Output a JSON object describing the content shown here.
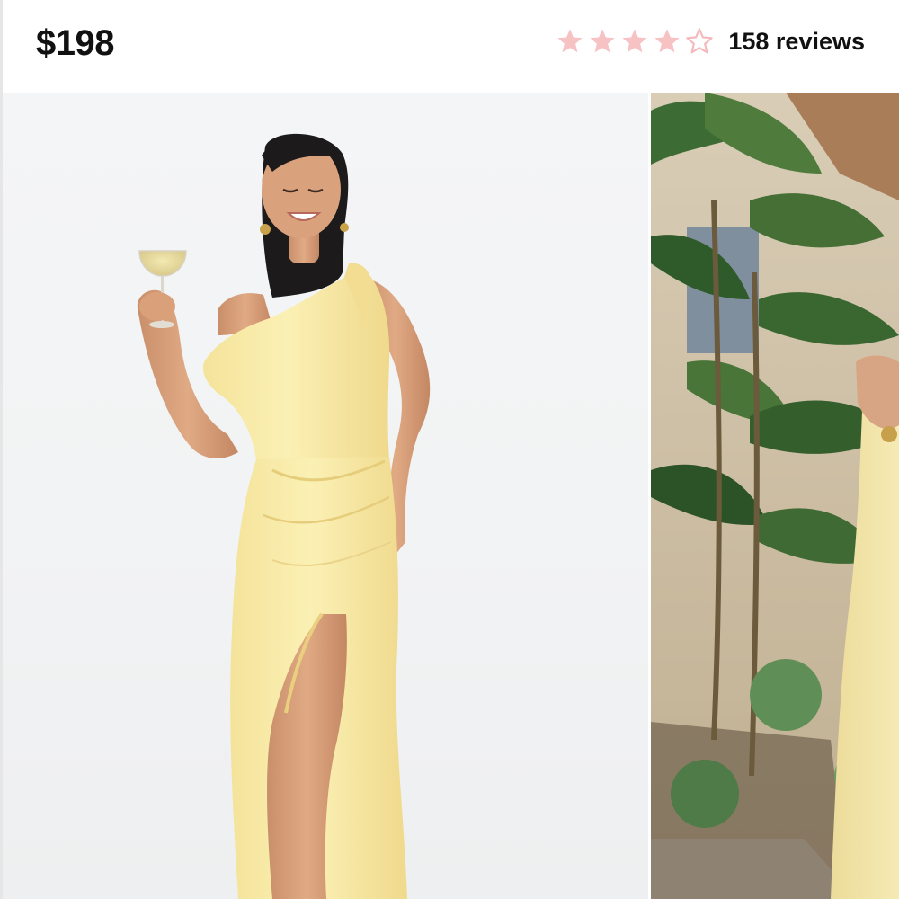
{
  "product": {
    "price": "$198",
    "rating": {
      "value": 4,
      "max": 5,
      "reviews_label": "158 reviews",
      "filled_color": "#f6c2c4",
      "empty_color": "#f3b9bc"
    }
  },
  "gallery": {
    "slides": [
      {
        "alt": "Model in yellow satin one-shoulder maxi dress holding a champagne glass"
      },
      {
        "alt": "Model in yellow satin dress beside tropical plants"
      }
    ],
    "accent": "#f7ec9f"
  },
  "icons": {
    "star_filled": "star-icon",
    "star_empty": "star-outline-icon"
  }
}
